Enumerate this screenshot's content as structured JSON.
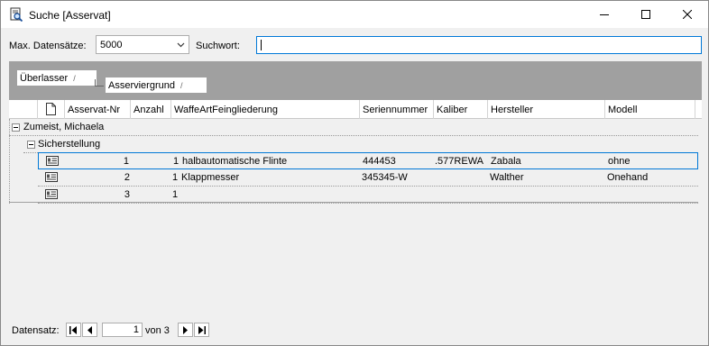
{
  "window": {
    "title": "Suche [Asservat]",
    "icon": "search-document-icon"
  },
  "filter": {
    "max_label": "Max. Datensätze:",
    "max_value": "5000",
    "search_label": "Suchwort:",
    "search_value": ""
  },
  "grouping": {
    "chips": [
      {
        "label": "Überlasser",
        "sort": "/"
      },
      {
        "label": "Asserviergrund",
        "sort": "/"
      }
    ]
  },
  "table": {
    "columns": [
      "Asservat-Nr",
      "Anzahl",
      "WaffeArtFeingliederung",
      "Seriennummer",
      "Kaliber",
      "Hersteller",
      "Modell"
    ],
    "group1": "Zumeist, Michaela",
    "group2": "Sicherstellung",
    "rows": [
      {
        "nr": "1",
        "anzahl": "1",
        "waffe": "halbautomatische Flinte",
        "serien": "444453",
        "kaliber": ".577REWA",
        "hersteller": "Zabala",
        "modell": "ohne",
        "selected": true
      },
      {
        "nr": "2",
        "anzahl": "1",
        "waffe": "Klappmesser",
        "serien": "345345-W",
        "kaliber": "",
        "hersteller": "Walther",
        "modell": "Onehand",
        "selected": false
      },
      {
        "nr": "3",
        "anzahl": "1",
        "waffe": "",
        "serien": "",
        "kaliber": "",
        "hersteller": "",
        "modell": "",
        "selected": false
      }
    ]
  },
  "navigator": {
    "label": "Datensatz:",
    "current": "1",
    "of_label": "von 3"
  }
}
